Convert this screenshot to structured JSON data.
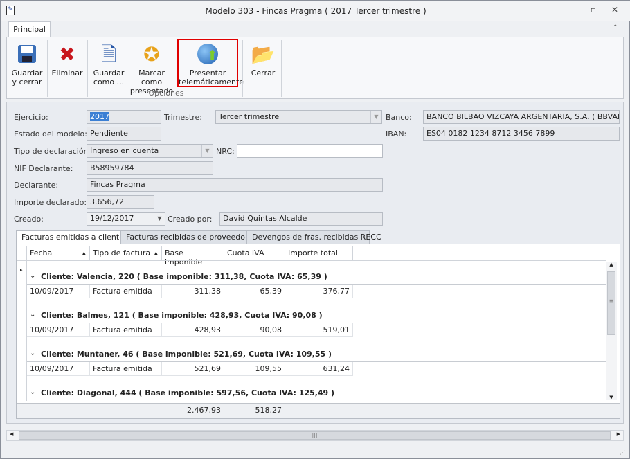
{
  "window": {
    "title": "Modelo 303 - Fincas Pragma ( 2017 Tercer trimestre )"
  },
  "ribbon": {
    "tab": "Principal",
    "group_label": "Opciones",
    "buttons": [
      {
        "label1": "Guardar",
        "label2": "y cerrar"
      },
      {
        "label1": "Eliminar",
        "label2": ""
      },
      {
        "label1": "Guardar",
        "label2": "como ..."
      },
      {
        "label1": "Marcar como",
        "label2": "presentado"
      },
      {
        "label1": "Presentar",
        "label2": "telemáticamente"
      },
      {
        "label1": "Cerrar",
        "label2": ""
      }
    ]
  },
  "form": {
    "ejercicio_label": "Ejercicio:",
    "ejercicio": "2017",
    "trimestre_label": "Trimestre:",
    "trimestre": "Tercer trimestre",
    "banco_label": "Banco:",
    "banco": "BANCO BILBAO VIZCAYA ARGENTARIA, S.A. ( BBVAESMM",
    "estado_label": "Estado del modelo:",
    "estado": "Pendiente",
    "iban_label": "IBAN:",
    "iban": "ES04 0182 1234 8712 3456 7899",
    "tipo_label": "Tipo de declaración:",
    "tipo": "Ingreso en cuenta",
    "nrc_label": "NRC:",
    "nrc": "",
    "nif_label": "NIF Declarante:",
    "nif": "B58959784",
    "declarante_label": "Declarante:",
    "declarante": "Fincas Pragma",
    "importe_label": "Importe declarado:",
    "importe": "3.656,72",
    "creado_label": "Creado:",
    "creado": "19/12/2017",
    "creado_por_label": "Creado por:",
    "creado_por": "David Quintas Alcalde"
  },
  "tabs": [
    "Facturas emitidas a clientes",
    "Facturas recibidas de proveedores",
    "Devengos de fras. recibidas RECC"
  ],
  "grid": {
    "columns": [
      "Fecha",
      "Tipo de factura",
      "Base imponible",
      "Cuota IVA",
      "Importe total"
    ],
    "groups": [
      {
        "title": "Cliente: Valencia, 220 ( Base imponible: 311,38, Cuota IVA: 65,39 )",
        "row": [
          "10/09/2017",
          "Factura emitida",
          "311,38",
          "65,39",
          "376,77"
        ]
      },
      {
        "title": "Cliente: Balmes, 121 ( Base imponible: 428,93, Cuota IVA: 90,08 )",
        "row": [
          "10/09/2017",
          "Factura emitida",
          "428,93",
          "90,08",
          "519,01"
        ]
      },
      {
        "title": "Cliente: Muntaner, 46 ( Base imponible: 521,69, Cuota IVA: 109,55 )",
        "row": [
          "10/09/2017",
          "Factura emitida",
          "521,69",
          "109,55",
          "631,24"
        ]
      },
      {
        "title": "Cliente: Diagonal, 444 ( Base imponible: 597,56, Cuota IVA: 125,49 )"
      }
    ],
    "totals": {
      "base": "2.467,93",
      "cuota": "518,27"
    }
  }
}
